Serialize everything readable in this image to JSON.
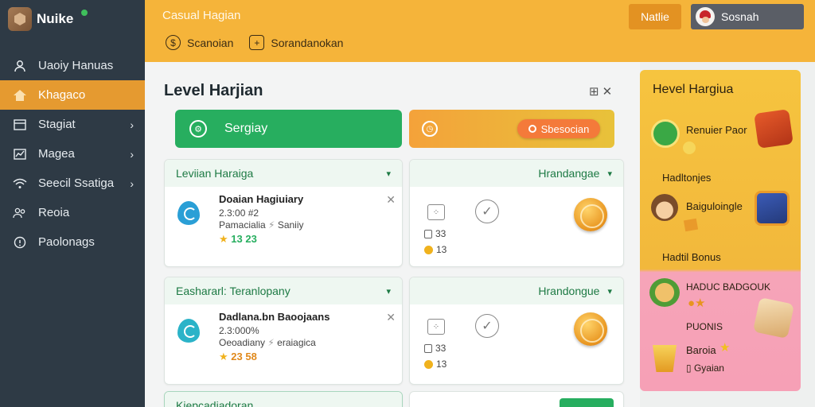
{
  "brand": {
    "name": "Nuike"
  },
  "sidebar": {
    "items": [
      {
        "label": "Uaoiy Hanuas",
        "icon": "person-icon",
        "active": false,
        "chevron": false
      },
      {
        "label": "Khagaco",
        "icon": "home-icon",
        "active": true,
        "chevron": false
      },
      {
        "label": "Stagiat",
        "icon": "layout-icon",
        "active": false,
        "chevron": true
      },
      {
        "label": "Magea",
        "icon": "chart-icon",
        "active": false,
        "chevron": true
      },
      {
        "label": "Seecil Ssatiga",
        "icon": "wifi-icon",
        "active": false,
        "chevron": true
      },
      {
        "label": "Reoia",
        "icon": "group-icon",
        "active": false,
        "chevron": false
      },
      {
        "label": "Paolonags",
        "icon": "info-icon",
        "active": false,
        "chevron": false
      }
    ]
  },
  "topbar": {
    "title": "Casual Hagian",
    "tools": [
      {
        "label": "Scanoian",
        "icon": "dollar-icon"
      },
      {
        "label": "Sorandanokan",
        "icon": "plus-box-icon"
      }
    ],
    "action_button": "Natlie",
    "user_name": "Sosnah"
  },
  "main": {
    "title": "Level Harjian",
    "green_button": "Sergiay",
    "orange_pill": "Sbesocian",
    "cards": [
      {
        "header": "Leviian Haraiga",
        "row_title": "Doaian Hagiuiary",
        "row_id": "2.3:00 #2",
        "row_meta_a": "Pamacialia",
        "row_meta_b": "Saniiy",
        "row_stat": "13 23"
      },
      {
        "header": "Eashararl: Teranlopany",
        "row_title": "Dadlana.bn Baoojaans",
        "row_id": "2.3:000%",
        "row_meta_a": "Oeoadiany",
        "row_meta_b": "eraiagica",
        "row_stat": "23 58"
      },
      {
        "header": "Kiepcadiadoran"
      }
    ],
    "right_cards": [
      {
        "header": "Hrandangae",
        "stat_a": "33",
        "stat_b": "13"
      },
      {
        "header": "Hrandongue",
        "stat_a": "33",
        "stat_b": "13"
      }
    ]
  },
  "rewards": {
    "title": "Hevel Hargiua",
    "items": [
      "Renuier Paor",
      "Hadltonjes",
      "Baiguloingle",
      "Hadtil Bonus",
      "HADUC BADGOUK",
      "PUONIS",
      "Baroia",
      "Gyaian"
    ]
  },
  "colors": {
    "sidebar": "#2e3a45",
    "active": "#e59a30",
    "topbar": "#f5b43a",
    "green": "#27ae5f"
  }
}
